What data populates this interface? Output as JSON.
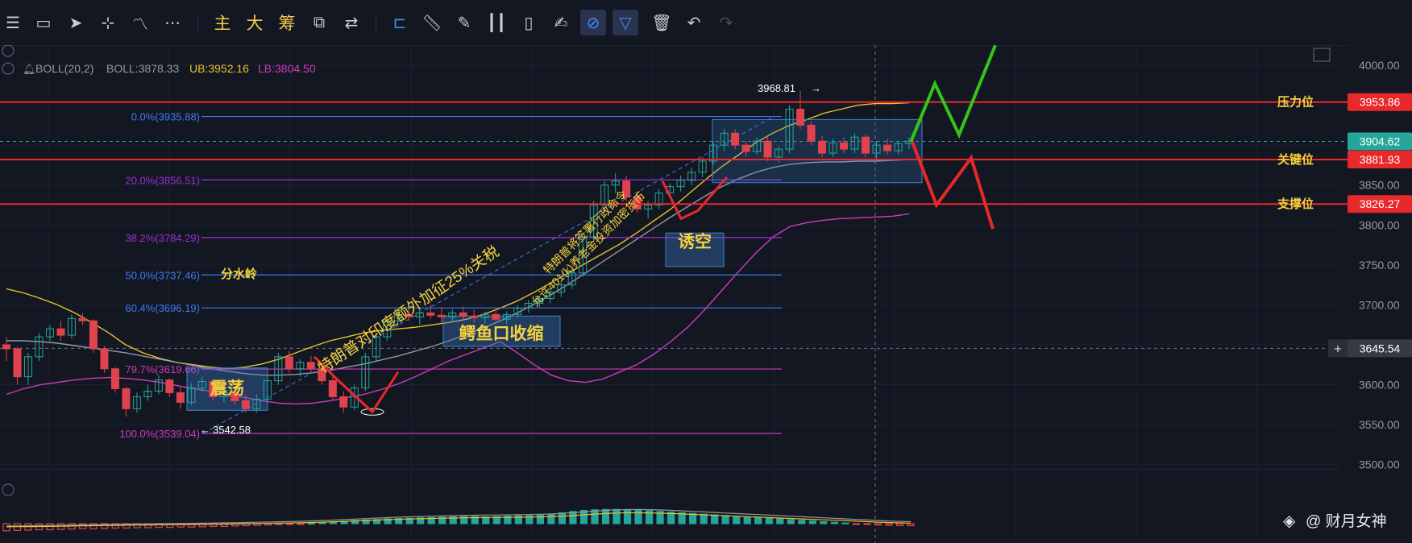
{
  "toolbar": {
    "text_tools": [
      "主",
      "大",
      "筹"
    ],
    "icons": [
      "menu-icon",
      "rectangle-icon",
      "cursor-icon",
      "crosshair-icon",
      "indicator-icon",
      "more-icon",
      "main-chart-tool",
      "major-tool",
      "chip-tool",
      "pattern-icon",
      "measure-icon",
      "bookmark-icon",
      "ruler-icon",
      "pencil-icon",
      "candle-icon",
      "clipboard-icon",
      "note-icon",
      "magnet-icon",
      "filter-icon",
      "trash-icon",
      "undo-icon",
      "redo-icon"
    ]
  },
  "indicator": {
    "name": "BOLL(20,2)",
    "boll": "BOLL:3878.33",
    "ub": "UB:3952.16",
    "lb": "LB:3804.50"
  },
  "colors": {
    "background": "#131722",
    "red_line": "#e8292b",
    "up_candle": "#26a69a",
    "down_candle": "#e0434f",
    "boll_mid": "#9598a1",
    "boll_upper": "#e6c229",
    "boll_lower": "#d03ac0",
    "fib_blue": "#3d7cf0",
    "fib_purple": "#9b30d8",
    "annotation_yellow": "#f5d23c",
    "green_arrow": "#35c31b"
  },
  "price_axis": {
    "ticks": [
      "4000.00",
      "3950.00",
      "3900.00",
      "3850.00",
      "3800.00",
      "3750.00",
      "3700.00",
      "3650.00",
      "3600.00",
      "3550.00",
      "3500.00"
    ]
  },
  "levels": [
    {
      "label": "压力位",
      "value": "3953.86"
    },
    {
      "label": "关键位",
      "value": "3881.93"
    },
    {
      "label": "支撑位",
      "value": "3826.27"
    }
  ],
  "current_price": "3904.62",
  "crosshair_price": "3645.54",
  "high_marker": "3968.81",
  "low_marker": "3542.58",
  "fib_levels": [
    {
      "label": "0.0%(3935.88)",
      "value": 3935.88
    },
    {
      "label": "20.0%(3856.51)",
      "value": 3856.51
    },
    {
      "label": "38.2%(3784.29)",
      "value": 3784.29
    },
    {
      "label": "50.0%(3737.46)",
      "value": 3737.46
    },
    {
      "label": "60.4%(3696.19)",
      "value": 3696.19
    },
    {
      "label": "79.7%(3619.66)",
      "value": 3619.66
    },
    {
      "label": "100.0%(3539.04)",
      "value": 3539.04
    }
  ],
  "annotations": {
    "watershed": "分水岭",
    "oscillation": "震荡",
    "alligator": "鳄鱼口收缩",
    "trap": "诱空",
    "tariff": "特朗普对印度额外加征25%关税",
    "order": "特朗普将签署行政命令",
    "pension": "允许401(k)养老金投资加密货币"
  },
  "watermark": "@ 财月女神",
  "chart_data": {
    "type": "candlestick",
    "y_range": [
      3465,
      4015
    ],
    "price_ticks": [
      4000,
      3950,
      3900,
      3850,
      3800,
      3750,
      3700,
      3650,
      3600,
      3550,
      3500
    ],
    "candles": [
      [
        3650,
        3660,
        3630,
        3645
      ],
      [
        3645,
        3648,
        3600,
        3610
      ],
      [
        3610,
        3640,
        3600,
        3635
      ],
      [
        3635,
        3665,
        3630,
        3660
      ],
      [
        3660,
        3675,
        3655,
        3670
      ],
      [
        3670,
        3680,
        3655,
        3662
      ],
      [
        3662,
        3688,
        3658,
        3683
      ],
      [
        3683,
        3690,
        3675,
        3680
      ],
      [
        3680,
        3682,
        3640,
        3645
      ],
      [
        3645,
        3648,
        3615,
        3620
      ],
      [
        3620,
        3622,
        3590,
        3595
      ],
      [
        3595,
        3598,
        3560,
        3570
      ],
      [
        3570,
        3590,
        3565,
        3585
      ],
      [
        3585,
        3600,
        3580,
        3592
      ],
      [
        3592,
        3612,
        3588,
        3606
      ],
      [
        3606,
        3608,
        3585,
        3590
      ],
      [
        3590,
        3598,
        3570,
        3578
      ],
      [
        3578,
        3602,
        3574,
        3596
      ],
      [
        3596,
        3610,
        3590,
        3604
      ],
      [
        3604,
        3606,
        3580,
        3585
      ],
      [
        3585,
        3596,
        3578,
        3590
      ],
      [
        3590,
        3598,
        3575,
        3580
      ],
      [
        3580,
        3588,
        3565,
        3570
      ],
      [
        3570,
        3588,
        3565,
        3582
      ],
      [
        3582,
        3610,
        3578,
        3605
      ],
      [
        3605,
        3640,
        3600,
        3635
      ],
      [
        3635,
        3642,
        3615,
        3620
      ],
      [
        3620,
        3632,
        3610,
        3628
      ],
      [
        3628,
        3636,
        3615,
        3620
      ],
      [
        3620,
        3625,
        3600,
        3605
      ],
      [
        3605,
        3610,
        3580,
        3585
      ],
      [
        3585,
        3592,
        3565,
        3572
      ],
      [
        3572,
        3600,
        3568,
        3596
      ],
      [
        3596,
        3640,
        3592,
        3635
      ],
      [
        3635,
        3665,
        3630,
        3660
      ],
      [
        3660,
        3685,
        3655,
        3680
      ],
      [
        3680,
        3695,
        3672,
        3688
      ],
      [
        3688,
        3698,
        3680,
        3685
      ],
      [
        3685,
        3695,
        3675,
        3690
      ],
      [
        3690,
        3700,
        3682,
        3687
      ],
      [
        3687,
        3696,
        3678,
        3685
      ],
      [
        3685,
        3695,
        3678,
        3690
      ],
      [
        3690,
        3698,
        3682,
        3686
      ],
      [
        3686,
        3694,
        3678,
        3684
      ],
      [
        3684,
        3692,
        3676,
        3688
      ],
      [
        3688,
        3695,
        3680,
        3682
      ],
      [
        3682,
        3692,
        3676,
        3688
      ],
      [
        3688,
        3700,
        3684,
        3696
      ],
      [
        3696,
        3706,
        3690,
        3702
      ],
      [
        3702,
        3712,
        3696,
        3708
      ],
      [
        3708,
        3720,
        3702,
        3716
      ],
      [
        3716,
        3730,
        3710,
        3725
      ],
      [
        3725,
        3745,
        3720,
        3740
      ],
      [
        3740,
        3790,
        3735,
        3785
      ],
      [
        3785,
        3830,
        3780,
        3825
      ],
      [
        3825,
        3855,
        3820,
        3850
      ],
      [
        3850,
        3865,
        3840,
        3855
      ],
      [
        3855,
        3862,
        3830,
        3835
      ],
      [
        3835,
        3842,
        3815,
        3820
      ],
      [
        3820,
        3830,
        3808,
        3825
      ],
      [
        3825,
        3845,
        3820,
        3840
      ],
      [
        3840,
        3852,
        3835,
        3848
      ],
      [
        3848,
        3862,
        3842,
        3856
      ],
      [
        3856,
        3872,
        3850,
        3866
      ],
      [
        3866,
        3885,
        3860,
        3880
      ],
      [
        3880,
        3905,
        3875,
        3900
      ],
      [
        3900,
        3920,
        3893,
        3915
      ],
      [
        3915,
        3920,
        3895,
        3900
      ],
      [
        3900,
        3905,
        3885,
        3892
      ],
      [
        3892,
        3910,
        3888,
        3905
      ],
      [
        3905,
        3910,
        3880,
        3885
      ],
      [
        3885,
        3898,
        3878,
        3895
      ],
      [
        3895,
        3950,
        3890,
        3945
      ],
      [
        3945,
        3968,
        3920,
        3925
      ],
      [
        3925,
        3930,
        3900,
        3905
      ],
      [
        3905,
        3912,
        3885,
        3890
      ],
      [
        3890,
        3908,
        3885,
        3903
      ],
      [
        3903,
        3910,
        3890,
        3895
      ],
      [
        3895,
        3915,
        3890,
        3910
      ],
      [
        3910,
        3914,
        3885,
        3890
      ],
      [
        3890,
        3905,
        3880,
        3900
      ],
      [
        3900,
        3908,
        3888,
        3893
      ],
      [
        3893,
        3905,
        3888,
        3902
      ],
      [
        3902,
        3910,
        3895,
        3905
      ]
    ],
    "boll_upper": [
      3720,
      3715,
      3708,
      3700,
      3690,
      3678,
      3665,
      3650,
      3640,
      3633,
      3628,
      3625,
      3622,
      3620,
      3622,
      3626,
      3632,
      3640,
      3648,
      3655,
      3660,
      3665,
      3668,
      3670,
      3672,
      3675,
      3678,
      3682,
      3688,
      3696,
      3705,
      3716,
      3728,
      3740,
      3752,
      3764,
      3776,
      3790,
      3805,
      3820,
      3838,
      3856,
      3873,
      3888,
      3903,
      3915,
      3925,
      3932,
      3940,
      3945,
      3950,
      3952,
      3952,
      3953
    ],
    "boll_mid": [
      3655,
      3655,
      3654,
      3652,
      3649,
      3646,
      3643,
      3640,
      3636,
      3632,
      3628,
      3624,
      3620,
      3617,
      3614,
      3612,
      3612,
      3613,
      3615,
      3618,
      3622,
      3626,
      3631,
      3636,
      3642,
      3648,
      3655,
      3663,
      3671,
      3680,
      3690,
      3701,
      3713,
      3726,
      3740,
      3754,
      3768,
      3782,
      3796,
      3810,
      3823,
      3836,
      3848,
      3858,
      3866,
      3872,
      3876,
      3878,
      3879,
      3879,
      3880,
      3880,
      3881,
      3882
    ],
    "boll_lower": [
      3588,
      3595,
      3600,
      3603,
      3606,
      3608,
      3609,
      3608,
      3606,
      3603,
      3599,
      3595,
      3592,
      3587,
      3584,
      3580,
      3577,
      3576,
      3577,
      3580,
      3584,
      3588,
      3594,
      3601,
      3610,
      3620,
      3630,
      3638,
      3646,
      3654,
      3640,
      3625,
      3612,
      3605,
      3603,
      3607,
      3616,
      3625,
      3638,
      3654,
      3672,
      3694,
      3718,
      3742,
      3765,
      3785,
      3798,
      3803,
      3806,
      3808,
      3809,
      3810,
      3811,
      3814
    ],
    "macd_hist": [
      -2.1,
      -2.0,
      -1.9,
      -1.8,
      -1.8,
      -1.7,
      -1.6,
      -1.5,
      -1.5,
      -1.4,
      -1.3,
      -1.3,
      -1.2,
      -1.2,
      -1.1,
      -1.1,
      -1.0,
      -1.0,
      -0.9,
      -0.8,
      -0.8,
      -0.7,
      -0.6,
      -0.5,
      -0.4,
      -0.3,
      -0.2,
      -0.1,
      0.1,
      0.3,
      0.5,
      0.7,
      0.9,
      1.1,
      1.2,
      1.4,
      1.5,
      1.6,
      1.7,
      1.8,
      1.9,
      2.0,
      2.1,
      2.1,
      2.0,
      2.1,
      2.2,
      2.3,
      2.4,
      2.5,
      2.8,
      3.2,
      3.6,
      3.9,
      4.1,
      4.2,
      4.2,
      4.1,
      4.0,
      3.8,
      3.6,
      3.4,
      3.2,
      3.0,
      2.8,
      2.6,
      2.4,
      2.2,
      2.0,
      1.8,
      1.6,
      1.4,
      1.2,
      1.0,
      0.8,
      0.6,
      0.4,
      0.2,
      -0.1,
      -0.2,
      -0.4,
      -0.5,
      -0.6,
      -0.6
    ]
  }
}
